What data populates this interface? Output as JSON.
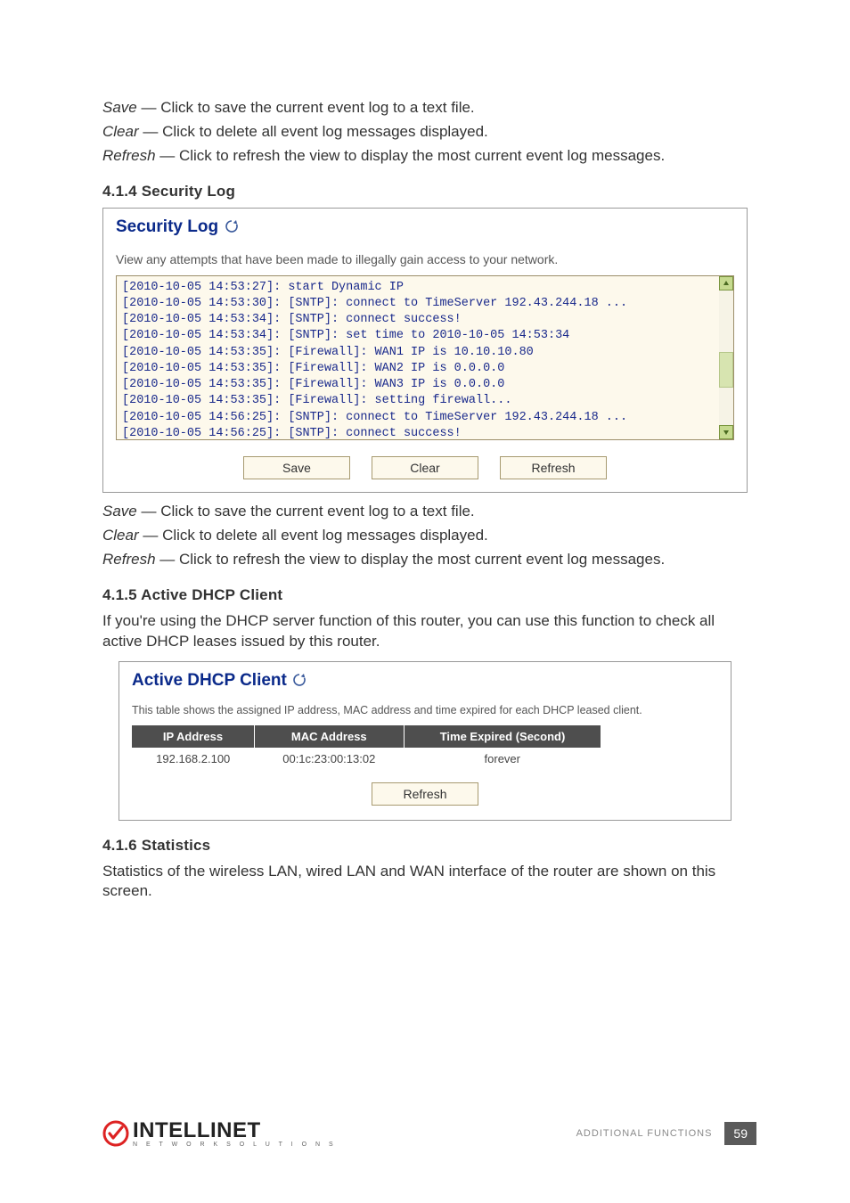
{
  "intro_defs": [
    {
      "term": "Save",
      "desc": " — Click to save the current event log to a text file."
    },
    {
      "term": "Clear",
      "desc": " — Click to delete all event log messages displayed."
    },
    {
      "term": "Refresh",
      "desc": " — Click to refresh the view to display the most current event log messages."
    }
  ],
  "section414": {
    "heading": "4.1.4  Security Log",
    "panel_title": "Security Log",
    "panel_subtitle": "View any attempts that have been made to illegally gain access to your network.",
    "log_lines": [
      "[2010-10-05 14:53:27]: start Dynamic IP",
      "[2010-10-05 14:53:30]: [SNTP]: connect to TimeServer 192.43.244.18 ...",
      "[2010-10-05 14:53:34]: [SNTP]: connect success!",
      "[2010-10-05 14:53:34]: [SNTP]: set time to 2010-10-05 14:53:34",
      "[2010-10-05 14:53:35]: [Firewall]: WAN1 IP is 10.10.10.80",
      "[2010-10-05 14:53:35]: [Firewall]: WAN2 IP is 0.0.0.0",
      "[2010-10-05 14:53:35]: [Firewall]: WAN3 IP is 0.0.0.0",
      "[2010-10-05 14:53:35]: [Firewall]: setting firewall...",
      "[2010-10-05 14:56:25]: [SNTP]: connect to TimeServer 192.43.244.18 ...",
      "[2010-10-05 14:56:25]: [SNTP]: connect success!"
    ],
    "buttons": {
      "save": "Save",
      "clear": "Clear",
      "refresh": "Refresh"
    }
  },
  "post_defs": [
    {
      "term": "Save",
      "desc": " — Click to save the current event log to a text file."
    },
    {
      "term": "Clear",
      "desc": " — Click to delete all event log messages displayed."
    },
    {
      "term": "Refresh",
      "desc": " — Click to refresh the view to display the most current event log messages."
    }
  ],
  "section415": {
    "heading": "4.1.5  Active DHCP Client",
    "intro": "If you're using the DHCP server function of this router, you can use this function to check all active DHCP leases issued by this router.",
    "panel_title": "Active DHCP Client",
    "panel_desc": "This table shows the assigned IP address, MAC address and time expired for each DHCP leased client.",
    "columns": [
      "IP Address",
      "MAC Address",
      "Time Expired (Second)"
    ],
    "rows": [
      {
        "ip": "192.168.2.100",
        "mac": "00:1c:23:00:13:02",
        "exp": "forever"
      }
    ],
    "refresh_label": "Refresh"
  },
  "section416": {
    "heading": "4.1.6  Statistics",
    "intro": "Statistics of the wireless LAN, wired LAN and WAN interface of the router are shown on this screen."
  },
  "footer": {
    "brand_main": "INTELLINET",
    "brand_sub": "N E T W O R K   S O L U T I O N S",
    "label": "ADDITIONAL FUNCTIONS",
    "page": "59"
  }
}
